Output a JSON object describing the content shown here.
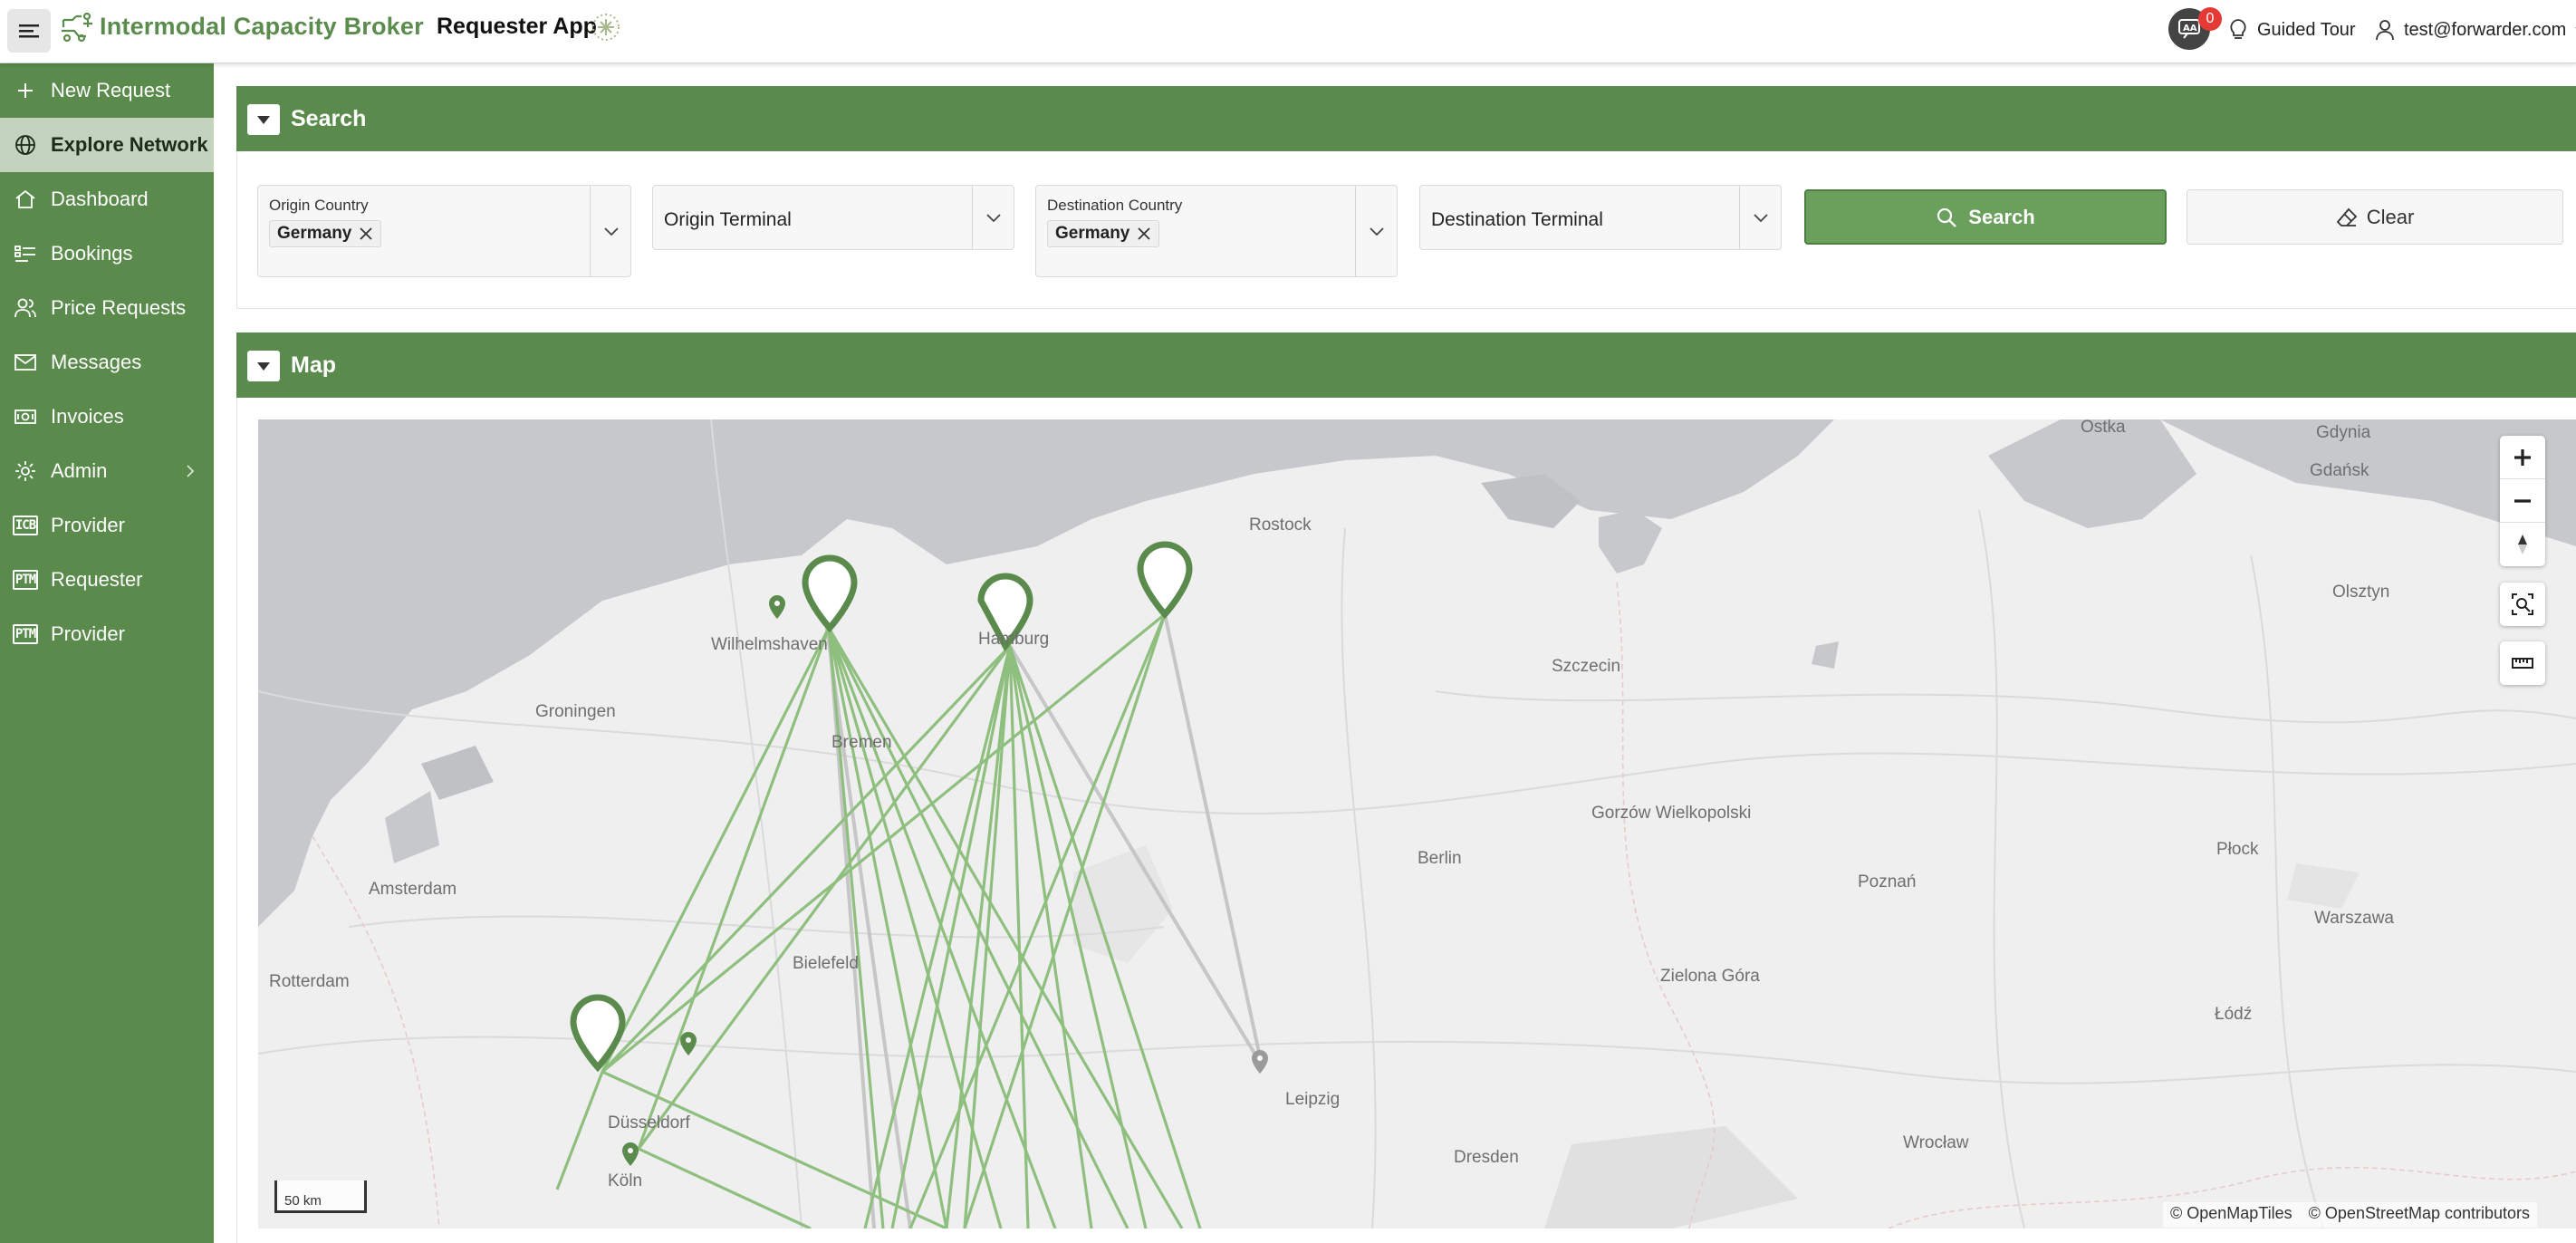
{
  "header": {
    "app_title": "Intermodal Capacity Broker",
    "app_subtitle": "Requester App",
    "notification_count": "0",
    "guided_tour_label": "Guided Tour",
    "user_email": "test@forwarder.com"
  },
  "sidebar": {
    "items": [
      {
        "label": "New Request",
        "icon": "plus-icon"
      },
      {
        "label": "Explore Network",
        "icon": "globe-icon",
        "active": true
      },
      {
        "label": "Dashboard",
        "icon": "home-icon"
      },
      {
        "label": "Bookings",
        "icon": "list-icon"
      },
      {
        "label": "Price Requests",
        "icon": "people-icon"
      },
      {
        "label": "Messages",
        "icon": "mail-icon"
      },
      {
        "label": "Invoices",
        "icon": "money-icon"
      },
      {
        "label": "Admin",
        "icon": "gear-icon",
        "has_submenu": true
      },
      {
        "label": "Provider",
        "icon": "icb-tag-icon",
        "tag": "ICB"
      },
      {
        "label": "Requester",
        "icon": "ptm-tag-icon",
        "tag": "PTM"
      },
      {
        "label": "Provider",
        "icon": "ptm-tag-icon",
        "tag": "PTM"
      }
    ]
  },
  "search_panel": {
    "title": "Search",
    "origin_country": {
      "label": "Origin Country",
      "selected": "Germany"
    },
    "origin_terminal": {
      "placeholder": "Origin Terminal"
    },
    "destination_country": {
      "label": "Destination Country",
      "selected": "Germany"
    },
    "destination_terminal": {
      "placeholder": "Destination Terminal"
    },
    "search_button": "Search",
    "clear_button": "Clear"
  },
  "map_panel": {
    "title": "Map",
    "scale_label": "50 km",
    "attribution": [
      "© OpenMapTiles",
      "© OpenStreetMap contributors"
    ],
    "cities": [
      "Gdynia",
      "Gdańsk",
      "Ostka",
      "Rostock",
      "Olsztyn",
      "Wilhelmshaven",
      "Hamburg",
      "Groningen",
      "Bremen",
      "Szczecin",
      "Gorzów Wielkopolski",
      "Berlin",
      "Poznań",
      "Płock",
      "Amsterdam",
      "Warszawa",
      "Bielefeld",
      "Rotterdam",
      "Zielona Góra",
      "Łódź",
      "Leipzig",
      "Düsseldorf",
      "Wrocław",
      "Dresden",
      "Köln"
    ]
  },
  "colors": {
    "brand_green": "#5a8a4c",
    "route_green": "#7fb26e",
    "badge_red": "#e53935"
  }
}
